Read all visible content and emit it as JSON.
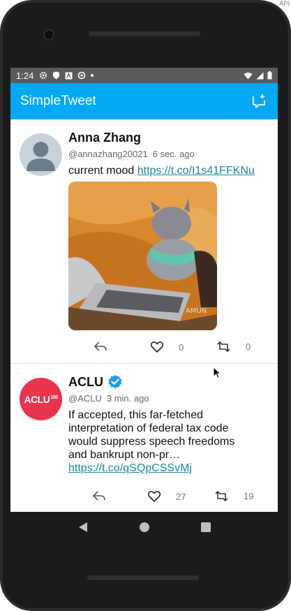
{
  "system": {
    "time": "1:24",
    "corner_label": "API"
  },
  "app": {
    "title": "SimpleTweet",
    "compose_icon": "compose-icon",
    "accent": "#03a9f4"
  },
  "tweets": [
    {
      "name": "Anna Zhang",
      "handle": "@annazhang20021",
      "time": "6 sec. ago",
      "text": "current mood",
      "link": "https://t.co/I1s41FFKNu",
      "media_watermark": "AMUN",
      "favorites": "0",
      "retweets": "0"
    },
    {
      "name": "ACLU",
      "verified": true,
      "avatar_text": "ACLU",
      "avatar_badge": "100",
      "handle": "@ACLU",
      "time": "3 min. ago",
      "text": "If accepted, this far-fetched interpretation of federal tax code would suppress speech freedoms and bankrupt non-pr…",
      "link": "https://t.co/qSQpCSSvMj",
      "favorites": "27",
      "retweets": "19"
    }
  ]
}
